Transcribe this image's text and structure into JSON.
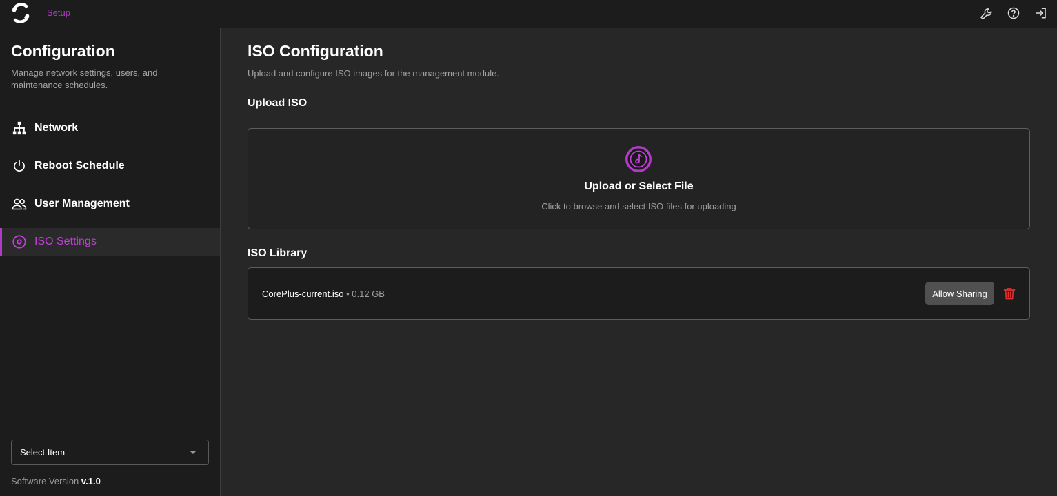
{
  "header": {
    "breadcrumb": "Setup",
    "icons": [
      "wrench-icon",
      "help-icon",
      "logout-icon"
    ]
  },
  "sidebar": {
    "title": "Configuration",
    "description": "Manage network settings, users, and maintenance schedules.",
    "items": [
      {
        "label": "Network",
        "icon": "network-icon"
      },
      {
        "label": "Reboot Schedule",
        "icon": "power-icon"
      },
      {
        "label": "User Management",
        "icon": "users-icon"
      },
      {
        "label": "ISO Settings",
        "icon": "disc-icon",
        "active": true
      }
    ],
    "select": {
      "value": "Select Item"
    },
    "version_label": "Software Version",
    "version_value": "v.1.0"
  },
  "main": {
    "title": "ISO Configuration",
    "description": "Upload and configure ISO images for the management module.",
    "upload": {
      "section_title": "Upload ISO",
      "title": "Upload or Select File",
      "subtitle": "Click to browse and select ISO files for uploading"
    },
    "library": {
      "section_title": "ISO Library",
      "files": [
        {
          "name": "CorePlus-current.iso",
          "size": " • 0.12 GB",
          "action_label": "Allow Sharing"
        }
      ]
    }
  },
  "colors": {
    "accent": "#b13ac6",
    "danger": "#e03030",
    "background": "#272727",
    "panel": "#1c1c1c"
  }
}
